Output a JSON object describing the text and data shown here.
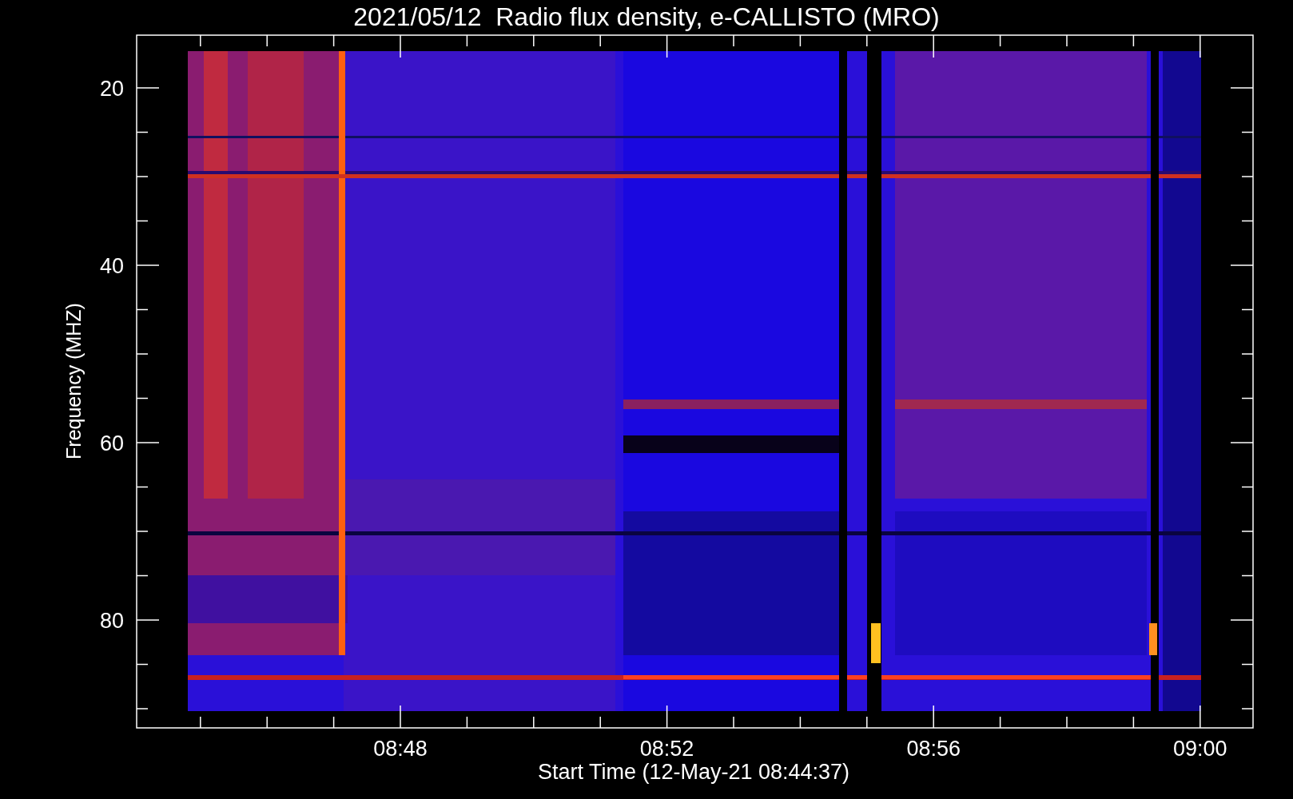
{
  "title": "2021/05/12  Radio flux density, e-CALLISTO (MRO)",
  "y_axis": {
    "label": "Frequency (MHZ)",
    "ticks": [
      "20",
      "40",
      "60",
      "80"
    ]
  },
  "x_axis": {
    "label": "Start Time (12-May-21 08:44:37)",
    "ticks": [
      "08:48",
      "08:52",
      "08:56",
      "09:00"
    ]
  }
}
